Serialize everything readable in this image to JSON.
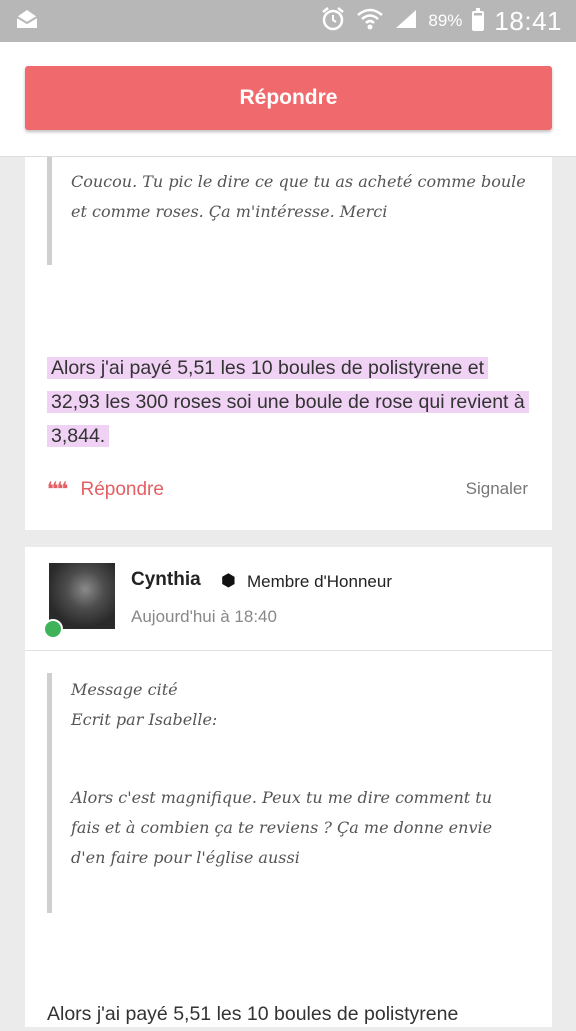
{
  "status_bar": {
    "battery_pct": "89%",
    "time": "18:41",
    "icons": [
      "mail-icon",
      "alarm-icon",
      "wifi-icon",
      "signal-icon",
      "battery-icon"
    ]
  },
  "header": {
    "reply_label": "Répondre"
  },
  "post1": {
    "quote_text": "Coucou. Tu pic le dire ce que tu as acheté comme boule et comme roses. Ça m'intéresse. Merci",
    "body": "Alors j'ai payé 5,51 les 10 boules de polistyrene et 32,93 les 300 roses soi une boule de rose qui revient à 3,844.",
    "reply_label": "Répondre",
    "report_label": "Signaler"
  },
  "post2": {
    "author": "Cynthia",
    "rank": "Membre d'Honneur",
    "timestamp": "Aujourd'hui à 18:40",
    "quote_header": "Message cité",
    "quote_author": "Ecrit par Isabelle:",
    "quote_text": "Alors c'est magnifique. Peux tu me dire comment tu fais et à combien ça te reviens ? Ça me donne envie d'en faire pour l'église aussi",
    "body": "Alors j'ai payé 5,51 les 10 boules de polistyrene"
  },
  "colors": {
    "accent": "#f06a6d",
    "highlight": "#f0d2f5",
    "online": "#3fb35a"
  }
}
